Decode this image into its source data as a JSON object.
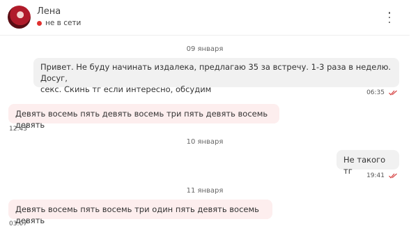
{
  "contact": {
    "name": "Лена",
    "status_text": "не в сети",
    "status_color": "#e0312f"
  },
  "icons": {
    "menu": "more-vertical-icon",
    "read": "double-check-icon"
  },
  "colors": {
    "read_checks": "#d64545",
    "incoming_bubble": "#fdeeee",
    "outgoing_bubble": "#f1f1f1"
  },
  "messages": {
    "date1": "09 января",
    "msg1": {
      "line1": "Привет. Не буду начинать издалека, предлагаю 35 за встречу. 1-3 раза в неделю. Досуг,",
      "line2": "секс. Скинь тг если интересно, обсудим",
      "time": "06:35"
    },
    "msg2": {
      "text": "Девять восемь пять девять восемь три пять девять восемь девять",
      "time": "12:43"
    },
    "date2": "10 января",
    "msg3": {
      "text": "Не такого тг",
      "time": "19:41"
    },
    "date3": "11 января",
    "msg4": {
      "text": "Девять восемь пять восемь три один пять девять восемь девять",
      "time": "03:07"
    }
  }
}
